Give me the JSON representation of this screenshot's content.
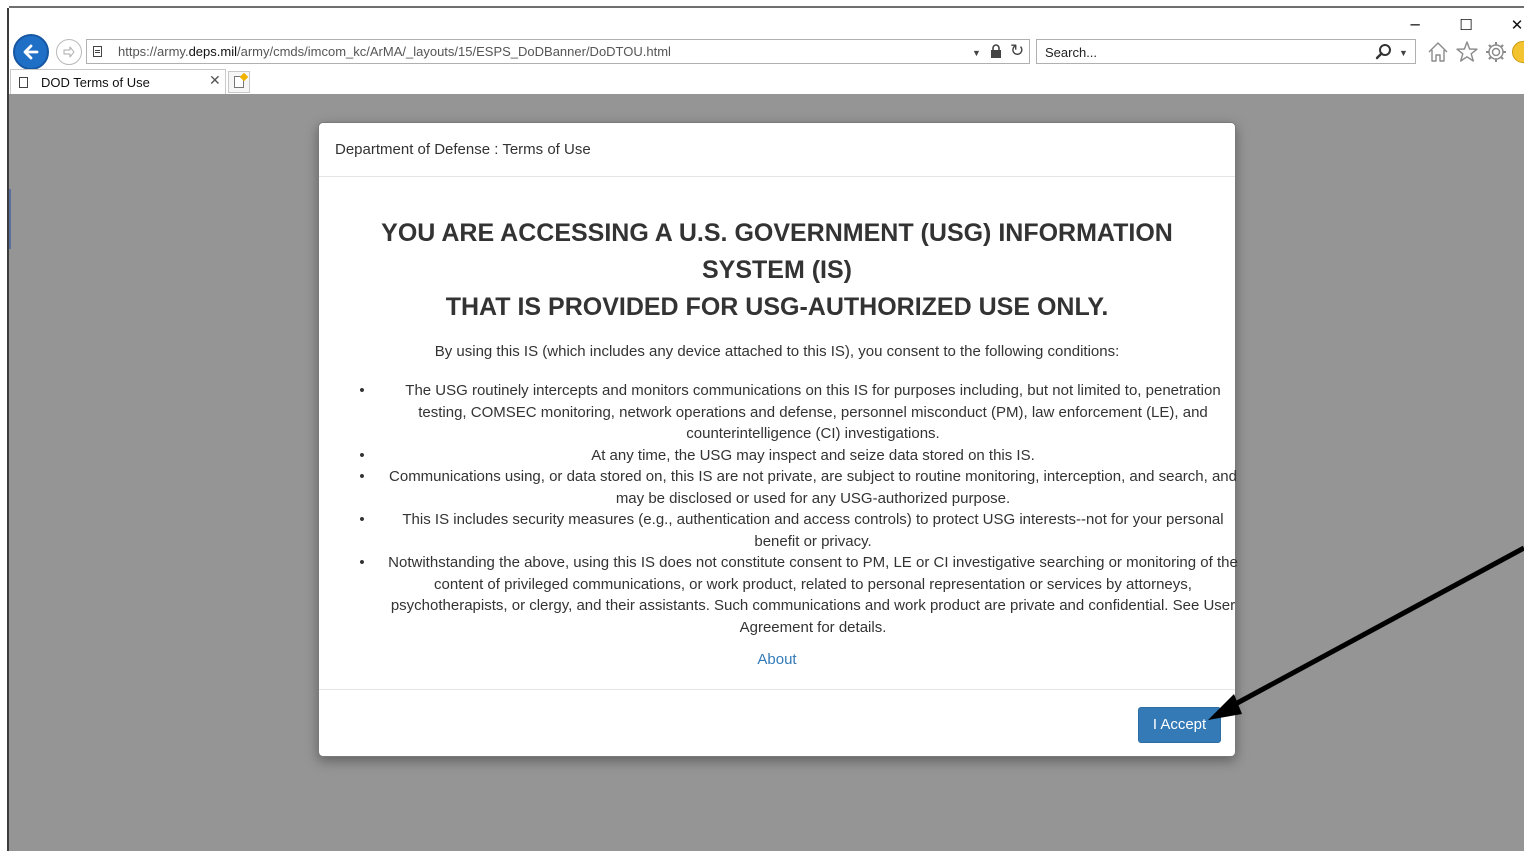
{
  "browser": {
    "url_prefix": "https://army.",
    "url_host": "deps.mil",
    "url_suffix": "/army/cmds/imcom_kc/ArMA/_layouts/15/ESPS_DoDBanner/DoDTOU.html",
    "search_placeholder": "Search...",
    "window_controls": {
      "minimize": "─",
      "maximize": "☐",
      "close": "✕"
    },
    "tabs": [
      {
        "title": "DOD Terms of Use",
        "close": "✕"
      }
    ],
    "refresh_glyph": "↻",
    "dropdown_glyph": "▼"
  },
  "modal": {
    "title": "Department of Defense : Terms of Use",
    "headline_lines": [
      "YOU ARE ACCESSING A U.S. GOVERNMENT (USG) INFORMATION",
      "SYSTEM (IS)",
      "THAT IS PROVIDED FOR USG-AUTHORIZED USE ONLY."
    ],
    "intro": "By using this IS (which includes any device attached to this IS), you consent to the following conditions:",
    "bullet": "•",
    "conditions": [
      "The USG routinely intercepts and monitors communications on this IS for purposes including, but not limited to, penetration testing, COMSEC monitoring, network operations and defense, personnel misconduct (PM), law enforcement (LE), and counterintelligence (CI) investigations.",
      "At any time, the USG may inspect and seize data stored on this IS.",
      "Communications using, or data stored on, this IS are not private, are subject to routine monitoring, interception, and search, and may be disclosed or used for any USG-authorized purpose.",
      "This IS includes security measures (e.g., authentication and access controls) to protect USG interests--not for your personal benefit or privacy.",
      "Notwithstanding the above, using this IS does not constitute consent to PM, LE or CI investigative searching or monitoring of the content of privileged communications, or work product, related to personal representation or services by attorneys, psychotherapists, or clergy, and their assistants. Such communications and work product are private and confidential. See User Agreement for details."
    ],
    "about_link": "About",
    "accept_button": "I Accept"
  },
  "colors": {
    "overlay": "#959595",
    "primary_button": "#337ab7",
    "link": "#337ab7",
    "browser_back": "#1f6fc6"
  }
}
